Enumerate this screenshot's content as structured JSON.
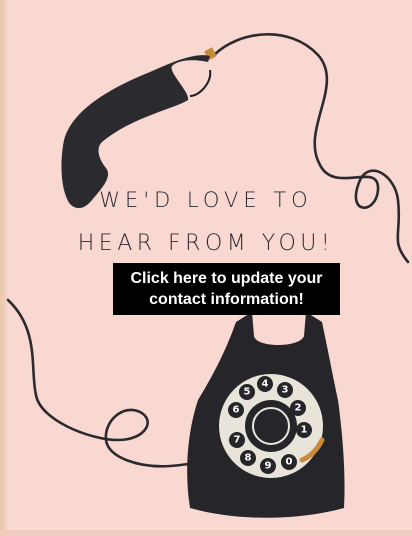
{
  "card": {
    "headline_line1": "WE'D LOVE TO",
    "headline_line2": "HEAR FROM YOU!"
  },
  "cta": {
    "line1": "Click here to update your",
    "line2": "contact information!"
  },
  "dial": {
    "digits": [
      "1",
      "2",
      "3",
      "4",
      "5",
      "6",
      "7",
      "8",
      "9",
      "0"
    ]
  },
  "colors": {
    "background": "#f8d8d0",
    "phone": "#2b2a2e",
    "button": "#000000",
    "button_text": "#ffffff",
    "accent": "#c98a3a"
  },
  "icons": {
    "handset": "telephone-handset-icon",
    "body": "rotary-telephone-icon"
  }
}
